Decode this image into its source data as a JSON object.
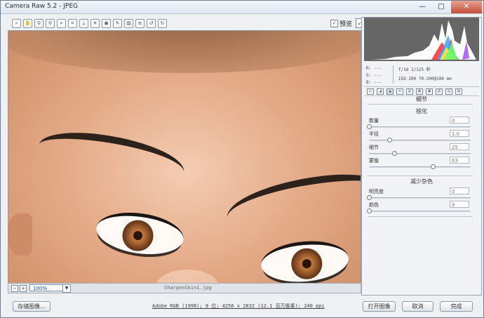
{
  "window": {
    "title": "Camera Raw 5.2 - JPEG",
    "minimize_icon": "minimize-icon",
    "maximize_icon": "maximize-icon",
    "close_icon": "close-icon"
  },
  "toolbar": {
    "tools": [
      {
        "name": "zoom-tool",
        "icon": "magnifier-icon",
        "glyph": "⌕"
      },
      {
        "name": "hand-tool",
        "icon": "hand-icon",
        "glyph": "✋"
      },
      {
        "name": "white-balance-tool",
        "icon": "eyedropper-icon",
        "glyph": "⚲"
      },
      {
        "name": "color-sampler-tool",
        "icon": "color-sampler-icon",
        "glyph": "⚲"
      },
      {
        "name": "target-adjustment-tool",
        "icon": "target-icon",
        "glyph": "⌖"
      },
      {
        "name": "crop-tool",
        "icon": "crop-icon",
        "glyph": "⌗"
      },
      {
        "name": "straighten-tool",
        "icon": "straighten-icon",
        "glyph": "⟂"
      },
      {
        "name": "spot-removal-tool",
        "icon": "spot-icon",
        "glyph": "✕"
      },
      {
        "name": "red-eye-tool",
        "icon": "red-eye-icon",
        "glyph": "◉"
      },
      {
        "name": "adjustment-brush-tool",
        "icon": "brush-icon",
        "glyph": "✎"
      },
      {
        "name": "graduated-filter-tool",
        "icon": "gradient-icon",
        "glyph": "▥"
      },
      {
        "name": "preferences-tool",
        "icon": "list-icon",
        "glyph": "≡"
      },
      {
        "name": "rotate-left-tool",
        "icon": "rotate-left-icon",
        "glyph": "↺"
      },
      {
        "name": "rotate-right-tool",
        "icon": "rotate-right-icon",
        "glyph": "↻"
      }
    ],
    "preview_label": "预览",
    "preview_checked": "✓",
    "fullscreen_icon": "fullscreen-icon",
    "fullscreen_glyph": "⤢"
  },
  "canvas": {
    "zoom_value": "100%",
    "filename": "SharpenSkin1.jpg",
    "zoom_out": "−",
    "zoom_in": "+",
    "zoom_dropdown": "▼"
  },
  "histogram": {
    "r": "R: ---",
    "g": "G: ---",
    "b": "B: ---"
  },
  "exif": {
    "line1": "f/16  1/125 秒",
    "line2": "ISO 200  70-200@100 mm"
  },
  "panel": {
    "tab_icons": [
      "basic-icon",
      "curve-icon",
      "detail-icon",
      "hsl-icon",
      "split-tone-icon",
      "lens-icon",
      "effects-icon",
      "camera-icon",
      "presets-icon",
      "snapshots-icon"
    ],
    "section": "细节",
    "sharpen_title": "锐化",
    "sharpen": [
      {
        "label": "数量",
        "value": "0",
        "position": 0
      },
      {
        "label": "半径",
        "value": "1.0",
        "position": 0.2
      },
      {
        "label": "细节",
        "value": "25",
        "position": 0.25
      },
      {
        "label": "蒙版",
        "value": "63",
        "position": 0.63
      }
    ],
    "noise_title": "减少杂色",
    "noise": [
      {
        "label": "明亮度",
        "value": "0",
        "position": 0
      },
      {
        "label": "颜色",
        "value": "0",
        "position": 0
      }
    ]
  },
  "footer": {
    "save_label": "存储图像...",
    "info": "Adobe RGB (1998); 8 位; 4256 x 2832 (12.1 百万像素); 240 ppi",
    "open_label": "打开图像",
    "cancel_label": "取消",
    "done_label": "完成"
  }
}
